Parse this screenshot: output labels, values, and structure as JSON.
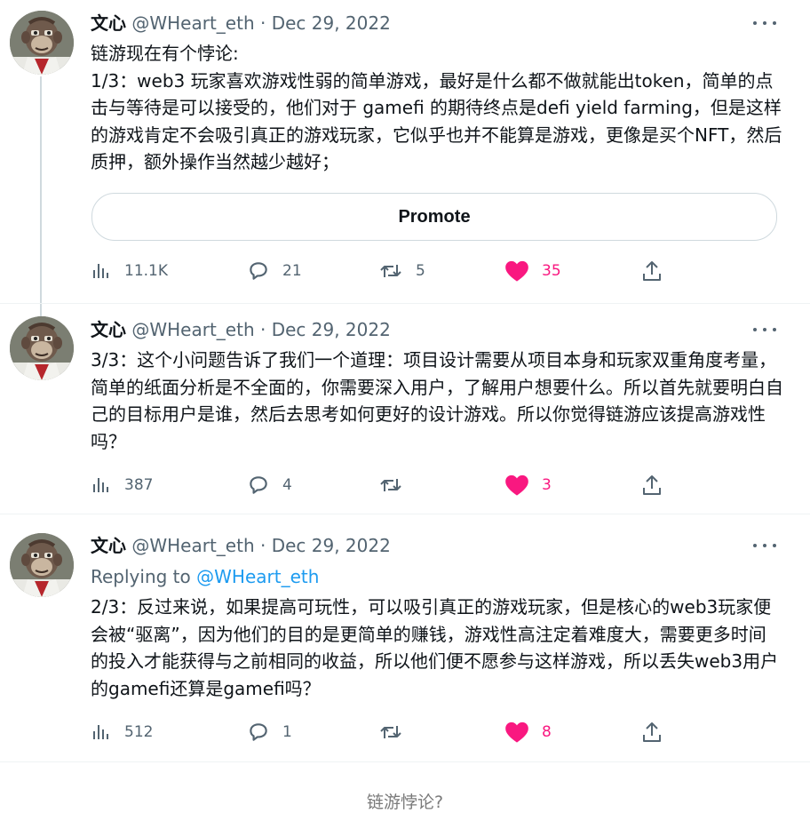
{
  "tweets": [
    {
      "name": "文心",
      "handle": "@WHeart_eth",
      "dot": "·",
      "date": "Dec 29, 2022",
      "text": "链游现在有个悖论:\n1/3：web3 玩家喜欢游戏性弱的简单游戏，最好是什么都不做就能出token，简单的点击与等待是可以接受的，他们对于 gamefi 的期待终点是defi yield farming，但是这样的游戏肯定不会吸引真正的游戏玩家，它似乎也并不能算是游戏，更像是买个NFT，然后质押，额外操作当然越少越好；",
      "promote": "Promote",
      "stats": {
        "views": "11.1K",
        "replies": "21",
        "retweets": "5",
        "likes": "35"
      }
    },
    {
      "name": "文心",
      "handle": "@WHeart_eth",
      "dot": "·",
      "date": "Dec 29, 2022",
      "text": "3/3：这个小问题告诉了我们一个道理：项目设计需要从项目本身和玩家双重角度考量，简单的纸面分析是不全面的，你需要深入用户，了解用户想要什么。所以首先就要明白自己的目标用户是谁，然后去思考如何更好的设计游戏。所以你觉得链游应该提高游戏性吗？",
      "stats": {
        "views": "387",
        "replies": "4",
        "retweets": "",
        "likes": "3"
      }
    },
    {
      "name": "文心",
      "handle": "@WHeart_eth",
      "dot": "·",
      "date": "Dec 29, 2022",
      "replying_to_label": "Replying to",
      "replying_to_handle": "@WHeart_eth",
      "text": "2/3：反过来说，如果提高可玩性，可以吸引真正的游戏玩家，但是核心的web3玩家便会被“驱离”，因为他们的目的是更简单的赚钱，游戏性高注定着难度大，需要更多时间的投入才能获得与之前相同的收益，所以他们便不愿参与这样游戏，所以丢失web3用户的gamefi还算是gamefi吗？",
      "stats": {
        "views": "512",
        "replies": "1",
        "retweets": "",
        "likes": "8"
      }
    }
  ],
  "icons": {
    "views": "bar-chart-icon",
    "reply": "speech-bubble-icon",
    "retweet": "retweet-arrows-icon",
    "like": "heart-icon",
    "share": "share-upload-icon",
    "more": "more-dots-icon"
  },
  "colors": {
    "like": "#f91880",
    "link": "#1d9bf0",
    "muted": "#536471"
  },
  "caption": "链游悖论?"
}
